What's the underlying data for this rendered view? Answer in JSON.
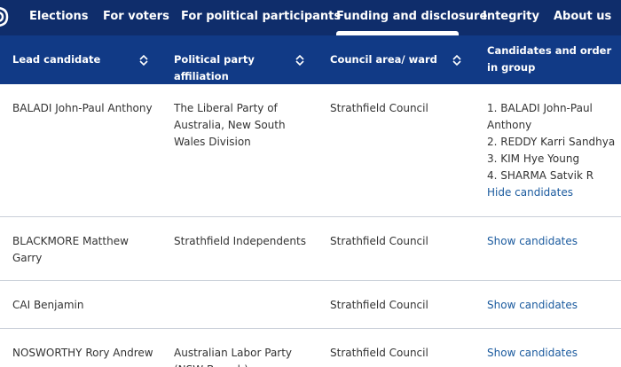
{
  "nav": {
    "items": [
      {
        "label": "Elections"
      },
      {
        "label": "For voters"
      },
      {
        "label": "For political participants"
      },
      {
        "label": "Funding and disclosure"
      },
      {
        "label": "Integrity"
      },
      {
        "label": "About us"
      }
    ]
  },
  "table": {
    "headers": [
      {
        "label": "Lead candidate"
      },
      {
        "label": "Political party affiliation"
      },
      {
        "label": "Council area/ ward"
      },
      {
        "label": "Candidates and order in group"
      }
    ],
    "rows": [
      {
        "lead": "BALADI John-Paul Anthony",
        "party": "The Liberal Party of Australia, New South Wales Division",
        "council": "Strathfield Council",
        "candidates": [
          "1. BALADI John-Paul Anthony",
          "2. REDDY Karri Sandhya",
          "3. KIM Hye Young",
          "4. SHARMA Satvik R"
        ],
        "toggle": "Hide candidates"
      },
      {
        "lead": "BLACKMORE Matthew Garry",
        "party": "Strathfield Independents",
        "council": "Strathfield Council",
        "toggle": "Show candidates"
      },
      {
        "lead": "CAI Benjamin",
        "party": "",
        "council": "Strathfield Council",
        "toggle": "Show candidates"
      },
      {
        "lead": "NOSWORTHY Rory Andrew",
        "party": "Australian Labor Party (NSW Branch)",
        "council": "Strathfield Council",
        "toggle": "Show candidates"
      }
    ]
  },
  "colors": {
    "nav_bg": "#0f2d6b",
    "header_bg": "#113a86",
    "link": "#1a5a9e"
  }
}
